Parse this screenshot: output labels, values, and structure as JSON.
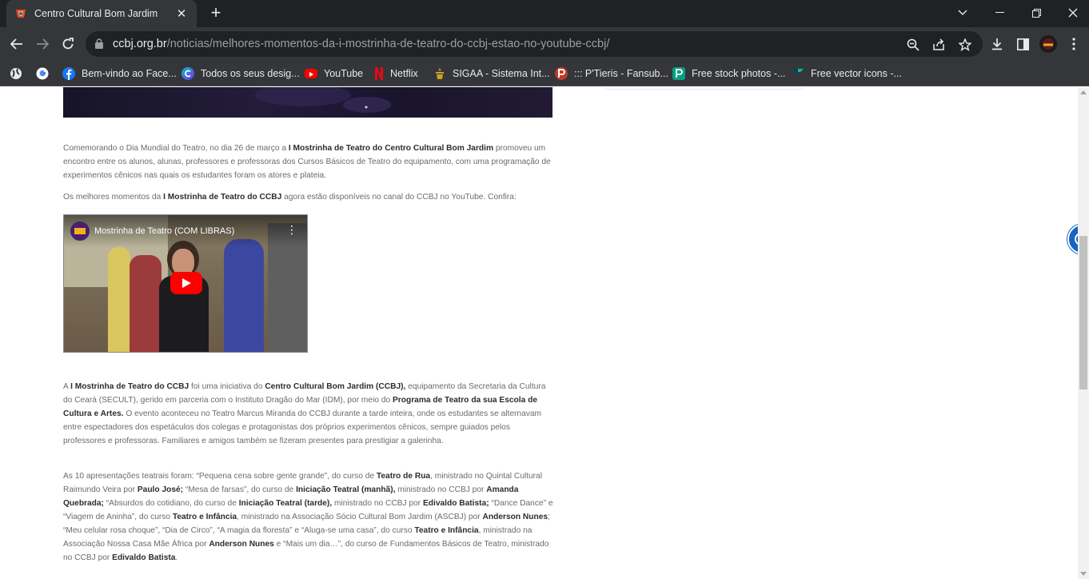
{
  "tab": {
    "title": "Centro Cultural Bom Jardim",
    "close_label": "✕"
  },
  "new_tab_label": "+",
  "window": {
    "minimize": "—",
    "maximize": "❐",
    "close": "✕",
    "tab_search": "⌄"
  },
  "omnibox": {
    "host": "ccbj.org.br",
    "path": "/noticias/melhores-momentos-da-i-mostrinha-de-teatro-do-ccbj-estao-no-youtube-ccbj/"
  },
  "bookmarks": [
    {
      "label": "",
      "icon": "globe-icon"
    },
    {
      "label": "",
      "icon": "google-icon"
    },
    {
      "label": "Bem-vindo ao Face...",
      "icon": "facebook-icon"
    },
    {
      "label": "Todos os seus desig...",
      "icon": "canva-icon"
    },
    {
      "label": "YouTube",
      "icon": "youtube-icon"
    },
    {
      "label": "Netflix",
      "icon": "netflix-icon"
    },
    {
      "label": "SIGAA - Sistema Int...",
      "icon": "sigaa-icon"
    },
    {
      "label": "::: P'Tieris - Fansub...",
      "icon": "ptieris-icon"
    },
    {
      "label": "Free stock photos -...",
      "icon": "pexels-icon"
    },
    {
      "label": "Free vector icons -...",
      "icon": "flaticon-icon"
    }
  ],
  "article": {
    "p1": {
      "t1": "Comemorando o Dia Mundial do Teatro, no dia 26 de março a ",
      "b1": "I Mostrinha de Teatro do Centro Cultural Bom Jardim",
      "t2": " promoveu um encontro entre os alunos, alunas, professores e professoras dos Cursos Básicos de Teatro do equipamento, com uma programação de experimentos cênicos nas quais os estudantes foram os atores e plateia."
    },
    "p2": {
      "t1": "Os melhores momentos da ",
      "b1": "I Mostrinha de Teatro do CCBJ",
      "t2": " agora estão disponíveis no canal do CCBJ no YouTube. Confira:"
    },
    "video": {
      "title": "Mostrinha de Teatro (COM LIBRAS)",
      "more": "⋮"
    },
    "p3": {
      "t1": "A ",
      "b1": "I Mostrinha de Teatro do CCBJ",
      "t2": " foi uma iniciativa do ",
      "b2": "Centro Cultural Bom Jardim (CCBJ),",
      "t3": " equipamento da Secretaria da Cultura do Ceará (SECULT), gerido em parceria com o Instituto Dragão do Mar (IDM), por meio do ",
      "b3": "Programa de Teatro da sua Escola de Cultura e Artes.",
      "t4": " O evento aconteceu no Teatro Marcus Miranda do CCBJ durante a tarde inteira, onde os estudantes se alternavam entre espectadores dos espetáculos dos colegas e protagonistas dos próprios experimentos cênicos, sempre guiados pelos professores e professoras. Familiares e amigos também se fizeram presentes para prestigiar a galerinha."
    },
    "p4": {
      "t1": "As 10 apresentações teatrais foram: “Pequena cena sobre gente grande”, do curso de ",
      "b1": "Teatro de Rua",
      "t2": ", ministrado no Quintal Cultural Raimundo Veira por ",
      "b2": "Paulo José;",
      "t3": " “Mesa de farsas”, do curso de ",
      "b3": "Iniciação Teatral (manhã),",
      "t4": " ministrado no CCBJ por ",
      "b4": "Amanda Quebrada;",
      "t5": " “Absurdos do cotidiano, do curso de ",
      "b5": "Iniciação Teatral (tarde),",
      "t6": " ministrado no CCBJ por ",
      "b6": "Edivaldo Batista;",
      "t7": " “Dance Dance” e “Viagem de Aninha”, do curso ",
      "b7": "Teatro e Infância",
      "t8": ", ministrado na Associação Sócio Cultural Bom Jardim (ASCBJ) por ",
      "b8": "Anderson Nunes",
      "t9": "; “Meu celular rosa choque”, “Dia de Circo”, “A magia da floresta” e “Aluga-se uma casa”, do curso ",
      "b9": "Teatro e Infância",
      "t10": ", ministrado na Associação Nossa Casa Mãe África por ",
      "b10": "Anderson Nunes",
      "t11": " e “Mais um dia…”, do curso de Fundamentos Básicos de Teatro, ministrado no CCBJ por ",
      "b11": "Edivaldo Batista",
      "t12": "."
    }
  }
}
